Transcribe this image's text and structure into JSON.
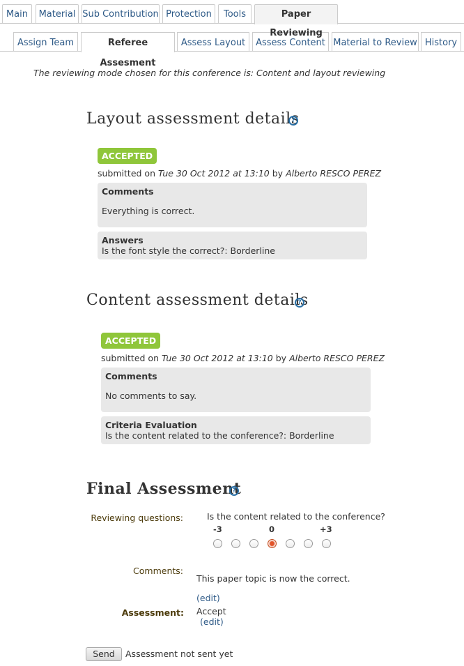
{
  "tabs_top": [
    {
      "label": "Main",
      "active": false
    },
    {
      "label": "Material",
      "active": false
    },
    {
      "label": "Sub Contribution",
      "active": false
    },
    {
      "label": "Protection",
      "active": false
    },
    {
      "label": "Tools",
      "active": false
    },
    {
      "label": "Paper Reviewing",
      "active": true
    }
  ],
  "tabs_sub": [
    {
      "label": "Assign Team",
      "active": false
    },
    {
      "label": "Referee Assesment",
      "active": true
    },
    {
      "label": "Assess Layout",
      "active": false
    },
    {
      "label": "Assess Content",
      "active": false
    },
    {
      "label": "Material to Review",
      "active": false
    },
    {
      "label": "History",
      "active": false
    }
  ],
  "mode_note": "The reviewing mode chosen for this conference is: Content and layout reviewing",
  "help_glyph": "?",
  "layout": {
    "title": "Layout assessment details",
    "status": "ACCEPTED",
    "submitted_prefix": "submitted on",
    "submitted_date": "Tue 30 Oct 2012 at 13:10",
    "submitted_by": "by",
    "reviewer": "Alberto RESCO PEREZ",
    "comments_label": "Comments",
    "comments_text": "Everything is correct.",
    "answers_label": "Answers",
    "answers_text": "Is the font style the correct?: Borderline"
  },
  "content": {
    "title": "Content assessment details",
    "status": "ACCEPTED",
    "submitted_prefix": "submitted on",
    "submitted_date": "Tue 30 Oct 2012 at 13:10",
    "submitted_by": "by",
    "reviewer": "Alberto RESCO PEREZ",
    "comments_label": "Comments",
    "comments_text": "No comments to say.",
    "criteria_label": "Criteria Evaluation",
    "criteria_text": "Is the content related to the conference?: Borderline"
  },
  "final": {
    "title": "Final Assessment",
    "questions_label": "Reviewing questions:",
    "question": "Is the content related to the conference?",
    "scale_min": "-3",
    "scale_mid": "0",
    "scale_max": "+3",
    "scale_options": 7,
    "selected_index": 3,
    "comments_label": "Comments:",
    "comments_text": "This paper topic is now the correct.",
    "comments_edit": "(edit)",
    "assessment_label": "Assessment:",
    "assessment_value": "Accept",
    "assessment_edit": "(edit)",
    "send_button": "Send",
    "send_status": "Assessment not sent yet"
  },
  "colors": {
    "accent_link": "#2e5a87",
    "badge_green": "#8fc63a",
    "label_brown": "#4c3b0b",
    "radio_selected": "#e2542a"
  }
}
